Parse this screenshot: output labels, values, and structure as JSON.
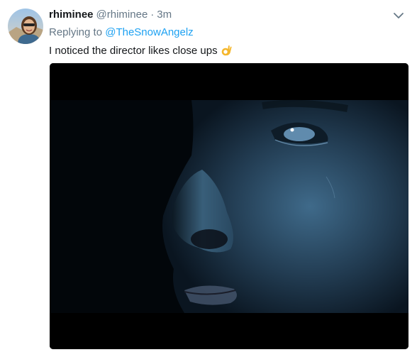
{
  "tweet": {
    "display_name": "rhiminee",
    "handle": "@rhiminee",
    "separator": "·",
    "timestamp": "3m",
    "replying_prefix": "Replying to",
    "replying_to": "@TheSnowAngelz",
    "text": "I noticed the director likes close ups",
    "emoji": "ok-hand-icon"
  },
  "icons": {
    "menu": "chevron-down-icon"
  },
  "colors": {
    "name": "#14171a",
    "secondary": "#657786",
    "link": "#1da1f2"
  }
}
